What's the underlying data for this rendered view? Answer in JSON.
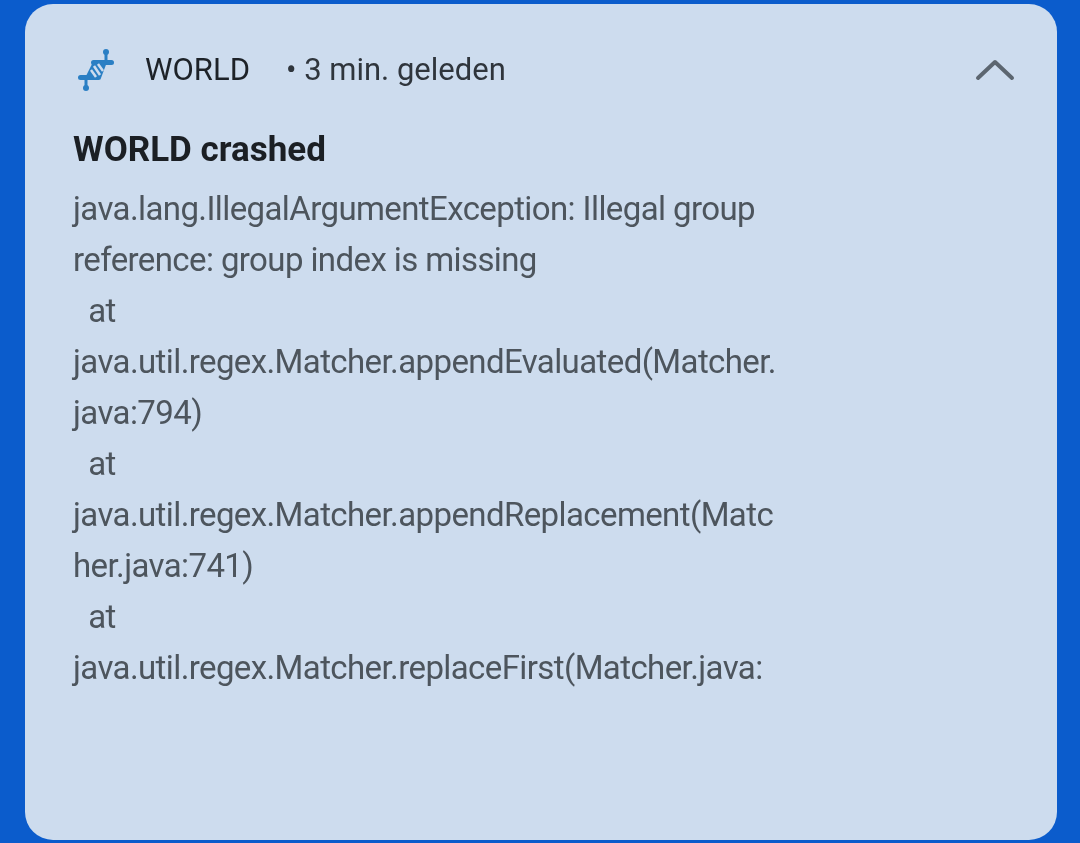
{
  "notification": {
    "app_name": "WORLD",
    "time": "• 3 min. geleden",
    "expanded": true,
    "title": "WORLD crashed",
    "body_lines": [
      "java.lang.IllegalArgumentException: Illegal group",
      "reference: group index is missing",
      "  at",
      "java.util.regex.Matcher.appendEvaluated(Matcher.",
      "java:794)",
      "  at",
      "java.util.regex.Matcher.appendReplacement(Matc",
      "her.java:741)",
      "  at",
      "java.util.regex.Matcher.replaceFirst(Matcher.java:"
    ]
  }
}
